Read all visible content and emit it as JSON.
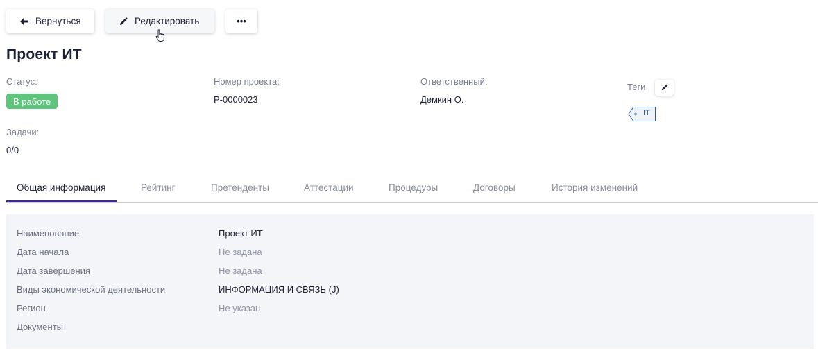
{
  "toolbar": {
    "back_label": "Вернуться",
    "edit_label": "Редактировать",
    "more_label": "•••"
  },
  "project": {
    "title": "Проект ИТ",
    "status_label": "Статус:",
    "status_value": "В работе",
    "number_label": "Номер проекта:",
    "number_value": "P-0000023",
    "owner_label": "Ответственный:",
    "owner_value": "Демкин О.",
    "tags_label": "Теги",
    "tags": [
      "IT"
    ],
    "tasks_label": "Задачи:",
    "tasks_value": "0/0"
  },
  "tabs": [
    {
      "label": "Общая информация",
      "active": true
    },
    {
      "label": "Рейтинг",
      "active": false
    },
    {
      "label": "Претенденты",
      "active": false
    },
    {
      "label": "Аттестации",
      "active": false
    },
    {
      "label": "Процедуры",
      "active": false
    },
    {
      "label": "Договоры",
      "active": false
    },
    {
      "label": "История изменений",
      "active": false
    }
  ],
  "info": {
    "rows": [
      {
        "key": "Наименование",
        "value": "Проект ИТ",
        "muted": false
      },
      {
        "key": "Дата начала",
        "value": "Не задана",
        "muted": true
      },
      {
        "key": "Дата завершения",
        "value": "Не задана",
        "muted": true
      },
      {
        "key": "Виды экономической деятельности",
        "value": "ИНФОРМАЦИЯ И СВЯЗЬ (J)",
        "muted": false
      },
      {
        "key": "Регион",
        "value": "Не указан",
        "muted": true
      },
      {
        "key": "Документы",
        "value": "",
        "muted": false
      }
    ]
  },
  "colors": {
    "status_green": "#5fc47c",
    "tab_accent": "#3b2a8f",
    "panel_bg": "#f4f5f9",
    "tag_blue": "#2e5c8a"
  },
  "icons": {
    "back": "arrow-left-icon",
    "edit": "pencil-icon",
    "more": "ellipsis-icon",
    "tag_edit": "pencil-icon",
    "cursor": "hand-pointer-icon"
  }
}
